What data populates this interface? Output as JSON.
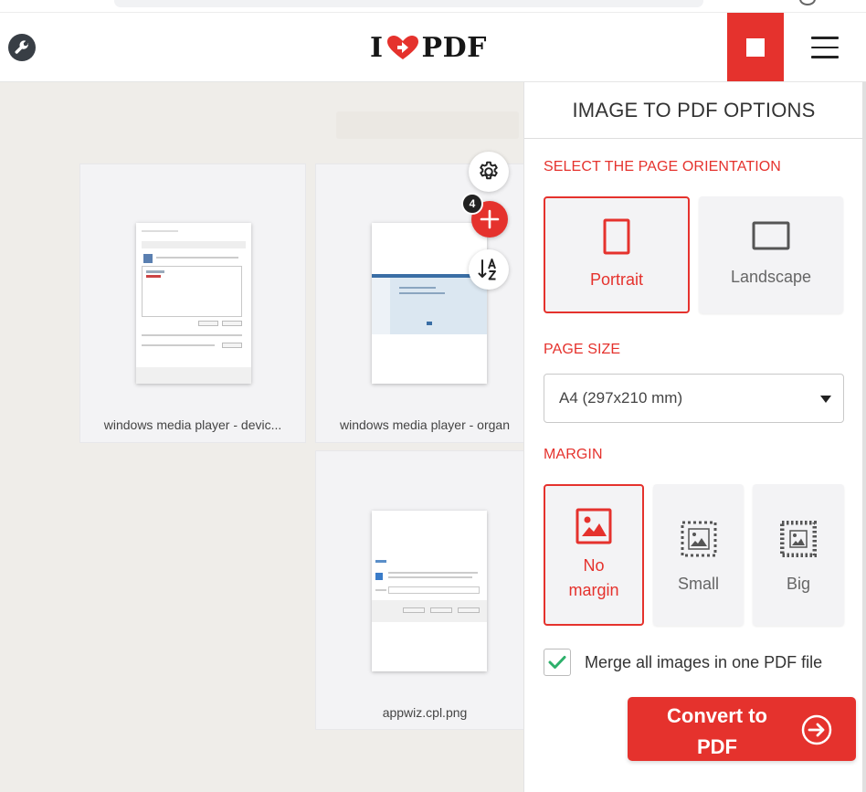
{
  "app": {
    "brand_left": "I",
    "brand_right": "PDF",
    "accent_color": "#e5322d"
  },
  "files": [
    {
      "name": "windows media player - devic...",
      "thumb": "media-player-devices-dialog"
    },
    {
      "name": "windows media player - organ",
      "thumb": "media-player-organize-window"
    },
    {
      "name": "appwiz.cpl.png",
      "thumb": "run-dialog"
    }
  ],
  "workspace": {
    "file_count": "4",
    "icons": {
      "settings": "gear-icon",
      "add": "plus-icon",
      "sort": "sort-az-icon"
    }
  },
  "panel": {
    "title": "IMAGE TO PDF OPTIONS",
    "orientation": {
      "label": "SELECT THE PAGE ORIENTATION",
      "options": [
        "Portrait",
        "Landscape"
      ],
      "selected": "Portrait"
    },
    "page_size": {
      "label": "PAGE SIZE",
      "value": "A4 (297x210 mm)"
    },
    "margin": {
      "label": "MARGIN",
      "options": {
        "none_line1": "No",
        "none_line2": "margin",
        "small": "Small",
        "big": "Big"
      },
      "selected": "No margin"
    },
    "merge": {
      "label": "Merge all images in one PDF file",
      "checked": true
    },
    "convert": {
      "line1": "Convert to",
      "line2": "PDF"
    }
  }
}
